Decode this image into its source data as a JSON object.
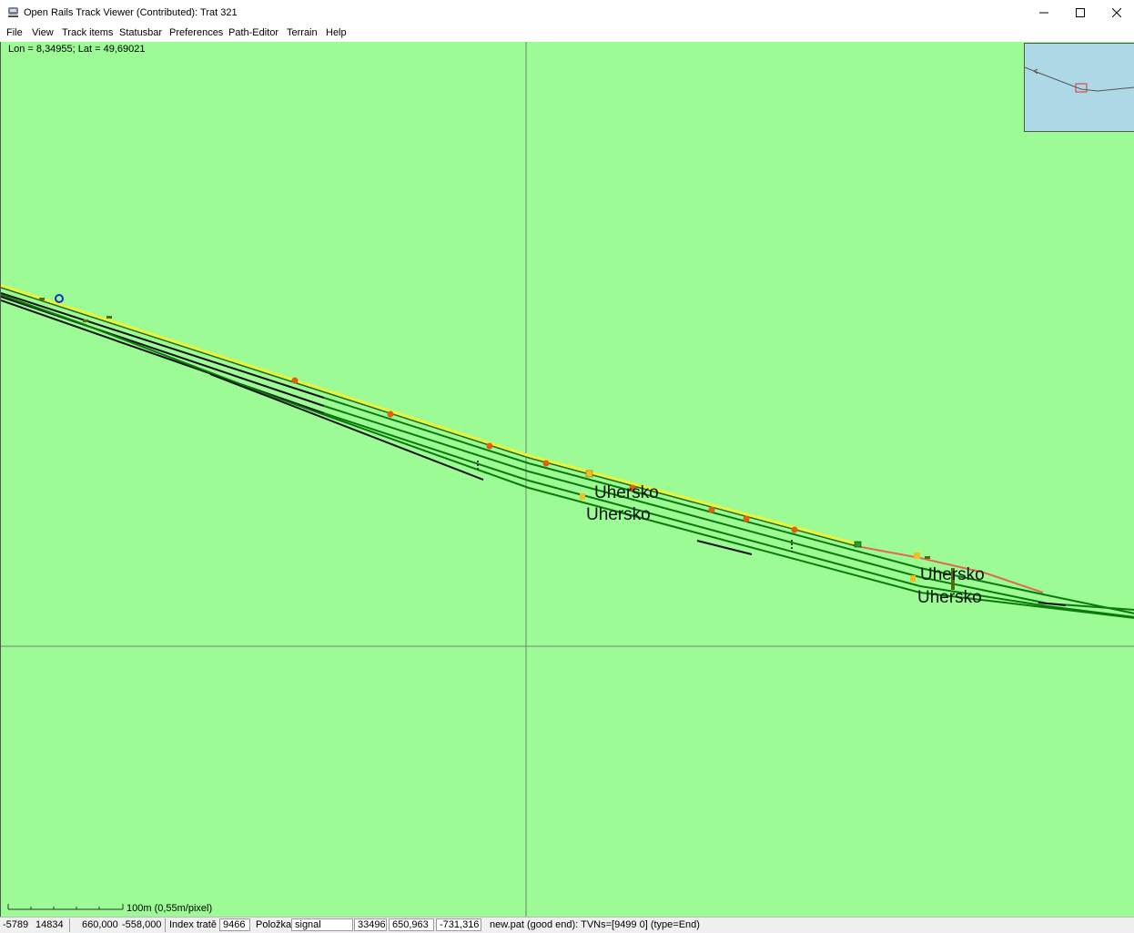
{
  "window": {
    "title": "Open Rails Track Viewer (Contributed): Trat 321",
    "icon": "train-icon"
  },
  "menu": {
    "items": [
      "File",
      "View",
      "Track items",
      "Statusbar",
      "Preferences",
      "Path-Editor",
      "Terrain",
      "Help"
    ]
  },
  "canvas": {
    "coords": "Lon = 8,34955; Lat = 49,69021",
    "stations": [
      "Uhersko",
      "Uhersko",
      "Uhersko",
      "Uhersko"
    ],
    "scale_label": "100m (0,55m/pixel)"
  },
  "colors": {
    "background": "#9cfb95",
    "minimap": "#add8e6",
    "track_green": "#0a7a0a",
    "track_black": "#111111",
    "path_yellow": "#e8f53a",
    "path_end_red": "#e06a50"
  },
  "statusbar": {
    "tile_x": "-5789",
    "tile_z": "14834",
    "loc_x": "660,000",
    "loc_z": "-558,000",
    "track_index_label": "Index tratě",
    "track_index": "9466",
    "item_label": "Položka",
    "item_value": "signal",
    "item_id": "33496",
    "item_x": "650,963",
    "item_z": "-731,316",
    "path_info": "new.pat (good end): TVNs=[9499 0] (type=End)"
  }
}
